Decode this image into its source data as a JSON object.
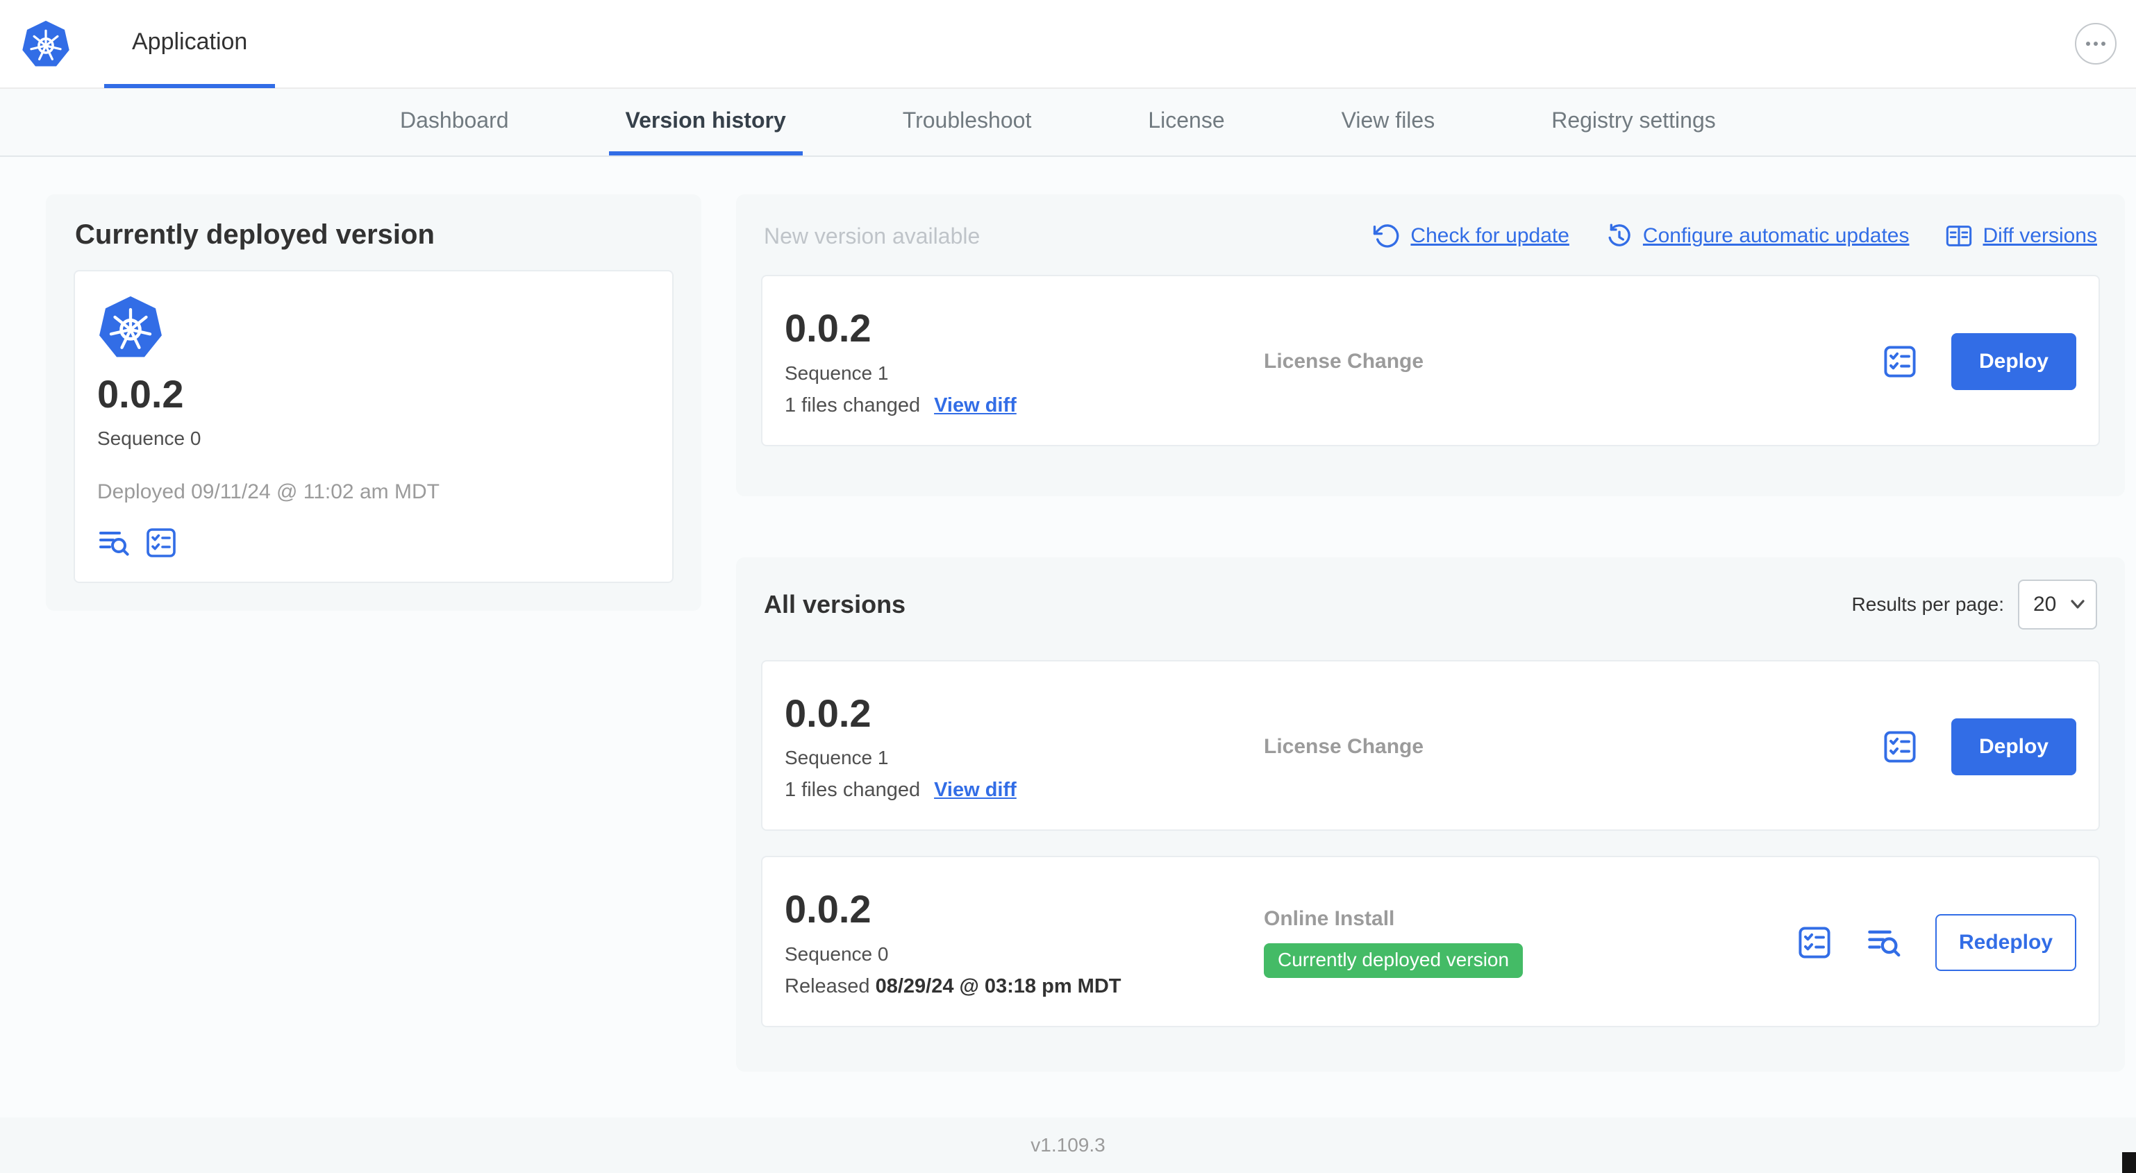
{
  "topbar": {
    "app_tab": "Application"
  },
  "nav": {
    "tabs": [
      {
        "label": "Dashboard",
        "active": false
      },
      {
        "label": "Version history",
        "active": true
      },
      {
        "label": "Troubleshoot",
        "active": false
      },
      {
        "label": "License",
        "active": false
      },
      {
        "label": "View files",
        "active": false
      },
      {
        "label": "Registry settings",
        "active": false
      }
    ]
  },
  "current_version": {
    "heading": "Currently deployed version",
    "version": "0.0.2",
    "sequence": "Sequence 0",
    "deployed": "Deployed 09/11/24 @ 11:02 am MDT"
  },
  "new_version": {
    "heading": "New version available",
    "check_for_update": "Check for update",
    "configure_updates": "Configure automatic updates",
    "diff_versions": "Diff versions",
    "card": {
      "version": "0.0.2",
      "sequence": "Sequence 1",
      "files_changed": "1 files changed",
      "view_diff": "View diff",
      "source": "License Change",
      "deploy": "Deploy"
    }
  },
  "all_versions": {
    "heading": "All versions",
    "results_per_page_label": "Results per page:",
    "results_per_page_value": "20",
    "rows": [
      {
        "version": "0.0.2",
        "sequence": "Sequence 1",
        "files_changed": "1 files changed",
        "view_diff": "View diff",
        "source": "License Change",
        "action": "Deploy"
      },
      {
        "version": "0.0.2",
        "sequence": "Sequence 0",
        "released_label": "Released",
        "released_date": "08/29/24 @ 03:18 pm MDT",
        "source": "Online Install",
        "badge": "Currently deployed version",
        "action": "Redeploy"
      }
    ]
  },
  "footer": {
    "version": "v1.109.3"
  },
  "icons": {
    "app_logo": "kubernetes-wheel",
    "overflow": "ellipsis",
    "check_for_update": "rotate-ccw-arrow",
    "configure_updates": "clock-with-arrow",
    "diff_versions": "split-table-diff",
    "release_notes": "text-lines-magnifier",
    "preflight": "checklist-square",
    "select_chevron": "chevron-down"
  },
  "colors": {
    "accent_blue": "#326de6",
    "badge_green": "#44bb66",
    "muted_gray": "#9b9b9b",
    "panel_gray": "#f5f8f9"
  }
}
